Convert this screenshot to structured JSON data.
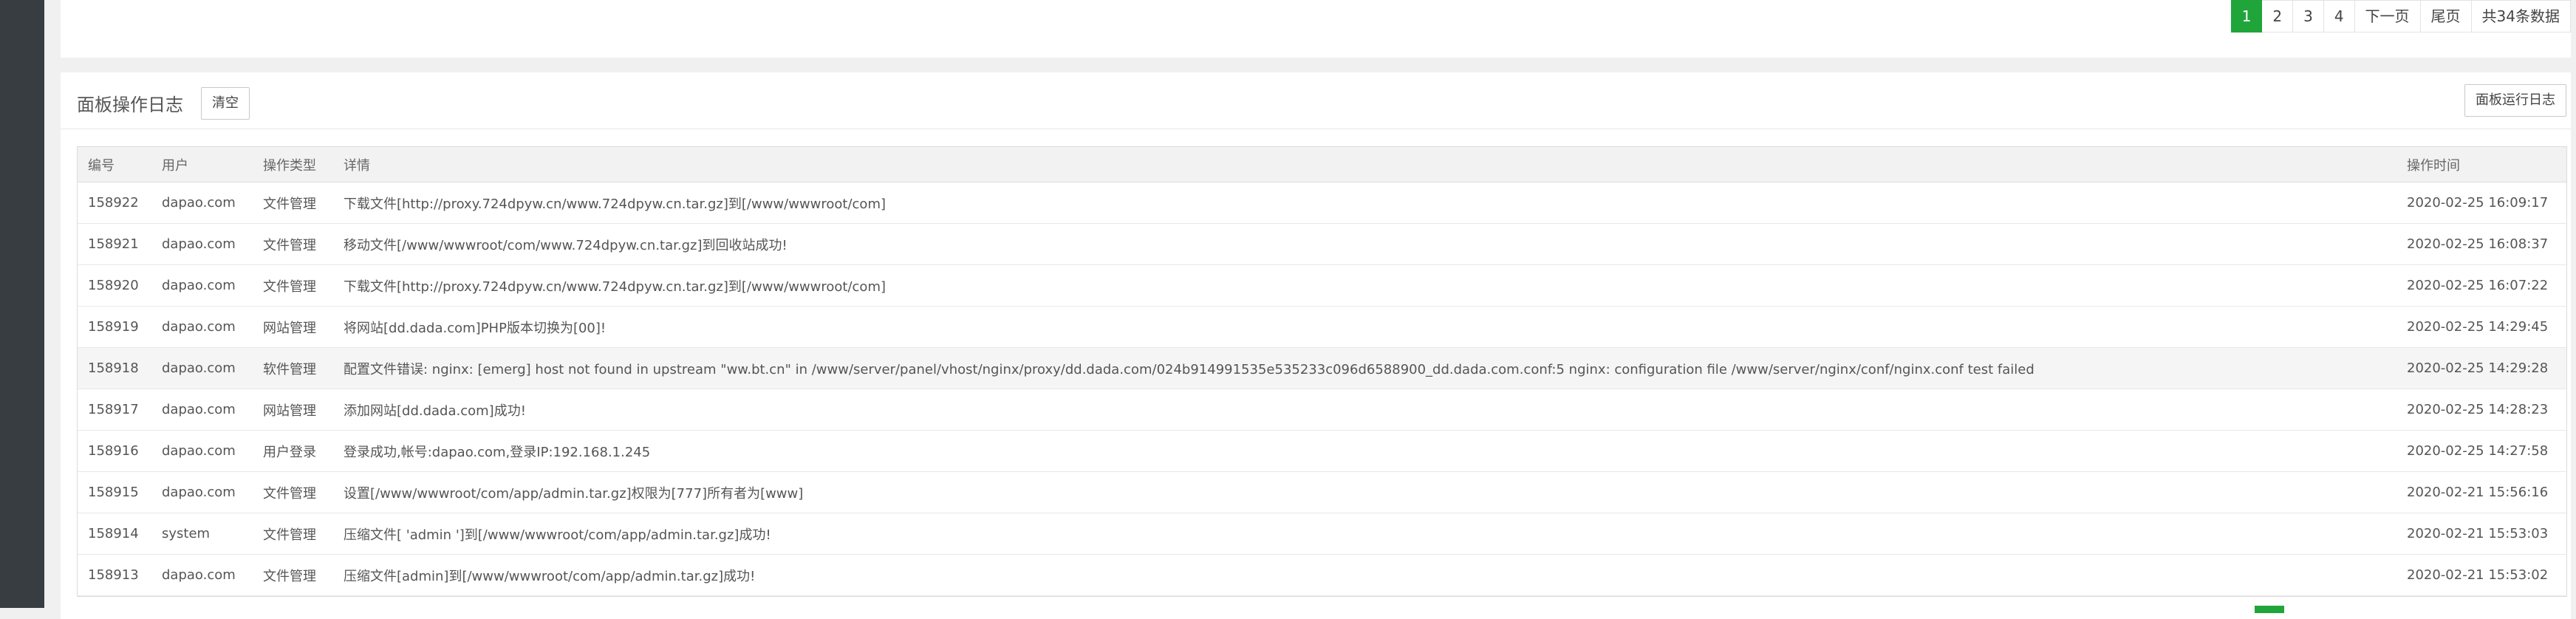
{
  "pagination_top": {
    "pages": [
      "1",
      "2",
      "3",
      "4"
    ],
    "active": "1",
    "next": "下一页",
    "last": "尾页",
    "total": "共34条数据"
  },
  "panel": {
    "title": "面板操作日志",
    "clear_label": "清空",
    "runlog_label": "面板运行日志"
  },
  "table": {
    "columns": [
      "编号",
      "用户",
      "操作类型",
      "详情",
      "操作时间"
    ],
    "rows": [
      {
        "id": "158922",
        "user": "dapao.com",
        "type": "文件管理",
        "detail": "下载文件[http://proxy.724dpyw.cn/www.724dpyw.cn.tar.gz]到[/www/wwwroot/com]",
        "time": "2020-02-25 16:09:17"
      },
      {
        "id": "158921",
        "user": "dapao.com",
        "type": "文件管理",
        "detail": "移动文件[/www/wwwroot/com/www.724dpyw.cn.tar.gz]到回收站成功!",
        "time": "2020-02-25 16:08:37"
      },
      {
        "id": "158920",
        "user": "dapao.com",
        "type": "文件管理",
        "detail": "下载文件[http://proxy.724dpyw.cn/www.724dpyw.cn.tar.gz]到[/www/wwwroot/com]",
        "time": "2020-02-25 16:07:22"
      },
      {
        "id": "158919",
        "user": "dapao.com",
        "type": "网站管理",
        "detail": "将网站[dd.dada.com]PHP版本切换为[00]!",
        "time": "2020-02-25 14:29:45"
      },
      {
        "id": "158918",
        "user": "dapao.com",
        "type": "软件管理",
        "detail": "配置文件错误: nginx: [emerg] host not found in upstream \"ww.bt.cn\" in /www/server/panel/vhost/nginx/proxy/dd.dada.com/024b914991535e535233c096d6588900_dd.dada.com.conf:5 nginx: configuration file /www/server/nginx/conf/nginx.conf test failed",
        "time": "2020-02-25 14:29:28"
      },
      {
        "id": "158917",
        "user": "dapao.com",
        "type": "网站管理",
        "detail": "添加网站[dd.dada.com]成功!",
        "time": "2020-02-25 14:28:23"
      },
      {
        "id": "158916",
        "user": "dapao.com",
        "type": "用户登录",
        "detail": "登录成功,帐号:dapao.com,登录IP:192.168.1.245",
        "time": "2020-02-25 14:27:58"
      },
      {
        "id": "158915",
        "user": "dapao.com",
        "type": "文件管理",
        "detail": "设置[/www/wwwroot/com/app/admin.tar.gz]权限为[777]所有者为[www]",
        "time": "2020-02-21 15:56:16"
      },
      {
        "id": "158914",
        "user": "system",
        "type": "文件管理",
        "detail": "压缩文件[ 'admin ']到[/www/wwwroot/com/app/admin.tar.gz]成功!",
        "time": "2020-02-21 15:53:03"
      },
      {
        "id": "158913",
        "user": "dapao.com",
        "type": "文件管理",
        "detail": "压缩文件[admin]到[/www/wwwroot/com/app/admin.tar.gz]成功!",
        "time": "2020-02-21 15:53:02"
      }
    ]
  },
  "colors": {
    "accent": "#20a53a",
    "sidebar": "#383d42"
  }
}
